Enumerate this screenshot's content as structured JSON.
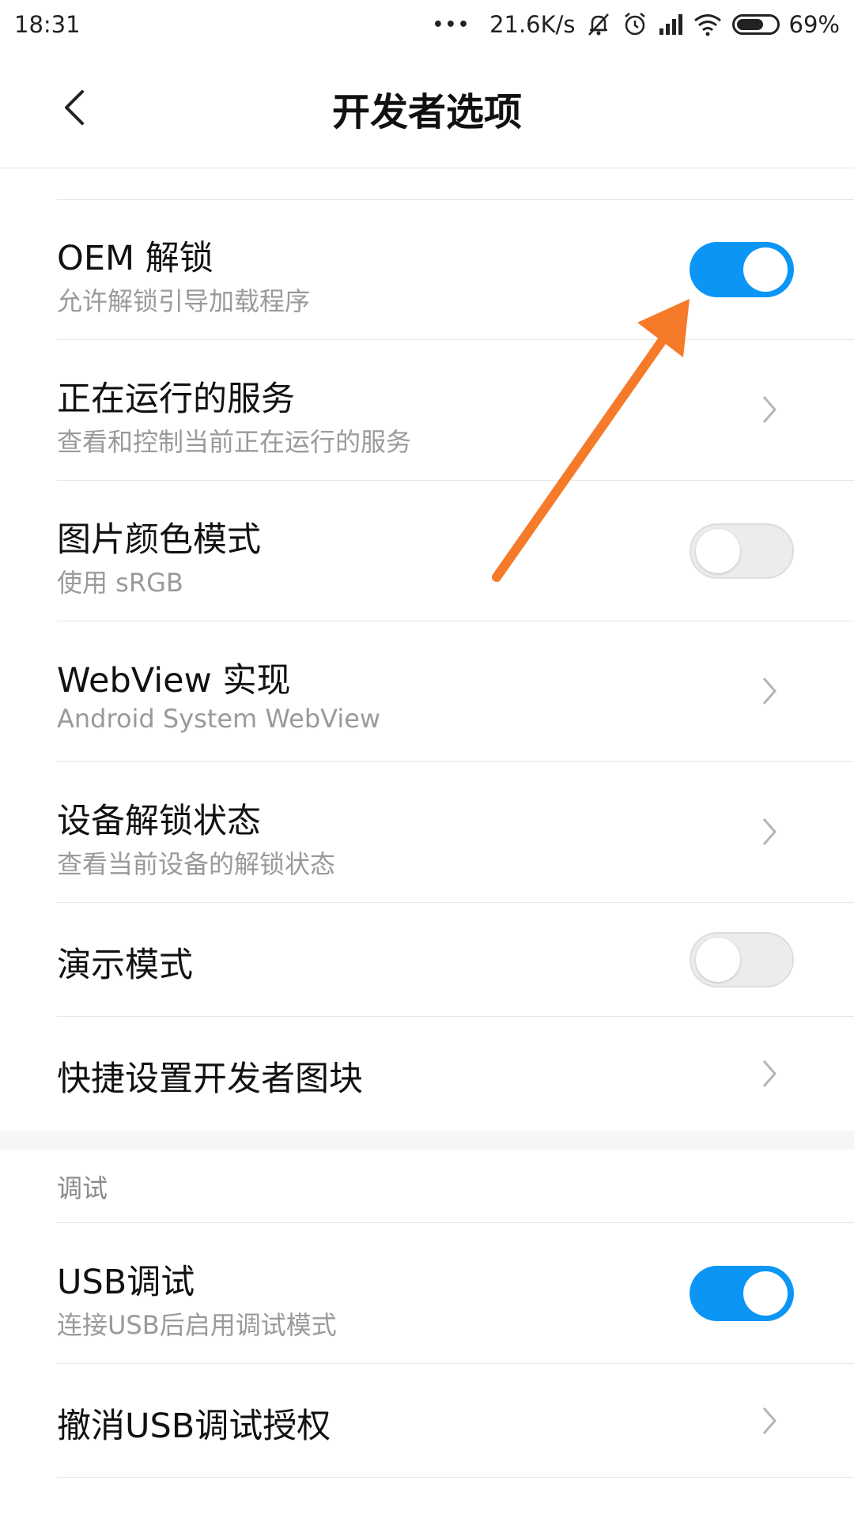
{
  "status_bar": {
    "time": "18:31",
    "dots": "•••",
    "speed": "21.6K/s",
    "battery_percent": "69%",
    "icons": [
      "mute-icon",
      "alarm-icon",
      "signal-icon",
      "wifi-icon",
      "battery-icon"
    ]
  },
  "header": {
    "title": "开发者选项",
    "back_icon": "back-chevron-icon"
  },
  "items": [
    {
      "title": "OEM 解锁",
      "subtitle": "允许解锁引导加载程序",
      "control": "toggle",
      "state": "on"
    },
    {
      "title": "正在运行的服务",
      "subtitle": "查看和控制当前正在运行的服务",
      "control": "chevron"
    },
    {
      "title": "图片颜色模式",
      "subtitle": "使用 sRGB",
      "control": "toggle",
      "state": "off"
    },
    {
      "title": "WebView 实现",
      "subtitle": "Android System WebView",
      "control": "chevron"
    },
    {
      "title": "设备解锁状态",
      "subtitle": "查看当前设备的解锁状态",
      "control": "chevron"
    },
    {
      "title": "演示模式",
      "control": "toggle",
      "state": "off"
    },
    {
      "title": "快捷设置开发者图块",
      "control": "chevron"
    }
  ],
  "section": {
    "label": "调试"
  },
  "debug_items": [
    {
      "title": "USB调试",
      "subtitle": "连接USB后启用调试模式",
      "control": "toggle",
      "state": "on"
    },
    {
      "title": "撤消USB调试授权",
      "control": "chevron"
    }
  ],
  "colors": {
    "toggle_on": "#0b96f5",
    "toggle_off": "#ececec",
    "annotation_arrow": "#f57a2a"
  }
}
